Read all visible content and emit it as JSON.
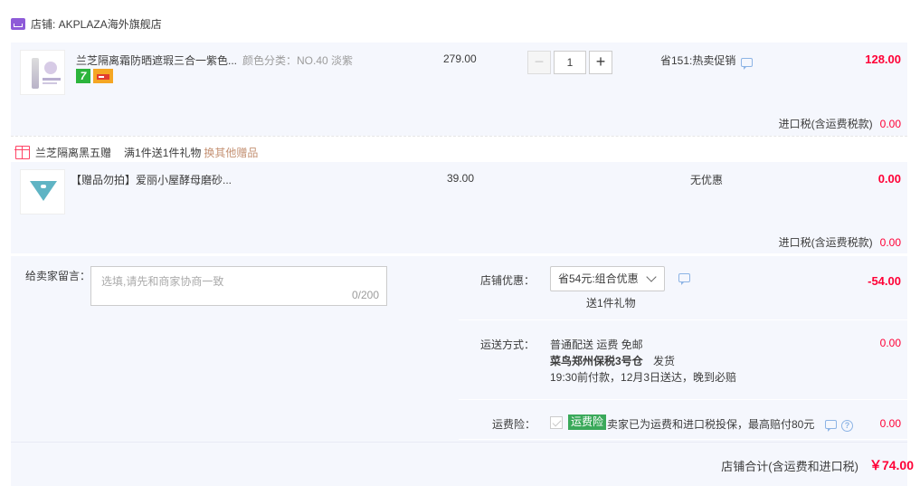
{
  "shop": {
    "label": "店铺: AKPLAZA海外旗舰店"
  },
  "item1": {
    "title": "兰芝隔离霜防晒遮瑕三合一紫色...",
    "sku": "颜色分类：NO.40 淡紫",
    "price": "279.00",
    "quantity": "1",
    "promo": "省151:热卖促销",
    "amount": "128.00",
    "tax_label": "进口税(含运费税款)",
    "tax_value": "0.00",
    "badges": [
      "7",
      "card-icon"
    ]
  },
  "gift": {
    "title": "兰芝隔离黑五赠",
    "rule": "满1件送1件礼物",
    "link": "换其他赠品"
  },
  "item2": {
    "title": "【赠品勿拍】爱丽小屋酵母磨砂...",
    "price": "39.00",
    "promo": "无优惠",
    "amount": "0.00",
    "tax_label": "进口税(含运费税款)",
    "tax_value": "0.00"
  },
  "note": {
    "label": "给卖家留言：",
    "placeholder": "选填,请先和商家协商一致",
    "count": "0/200"
  },
  "shop_discount": {
    "label": "店铺优惠：",
    "selected": "省54元:组合优惠",
    "gift_text": "送1件礼物",
    "amount": "-54.00"
  },
  "shipping": {
    "label": "运送方式：",
    "method": "普通配送 运费 免邮",
    "warehouse": "菜鸟郑州保税3号仓",
    "ship_text": "发货",
    "eta": "19:30前付款，12月3日送达，晚到必赔",
    "amount": "0.00"
  },
  "insurance": {
    "label": "运费险：",
    "badge": "运费险",
    "desc": "卖家已为运费和进口税投保，最高赔付80元",
    "amount": "0.00"
  },
  "total": {
    "label": "店铺合计(含运费和进口税)",
    "value": "￥74.00"
  },
  "colors": {
    "accent_red": "#ff0036",
    "shop_icon": "#8e5bd8",
    "gift_link": "#c49173",
    "insurance_green": "#3aa95a",
    "panel_bg": "#f5f7fd"
  },
  "icons": [
    "shop-icon",
    "gift-icon",
    "chat-icon",
    "help-icon",
    "chevron-down-icon",
    "checkbox-icon"
  ]
}
